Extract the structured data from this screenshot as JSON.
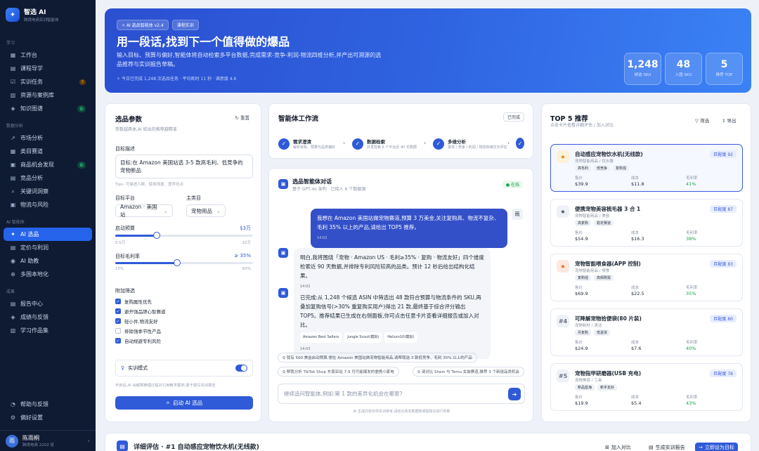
{
  "brand": {
    "name": "智选 AI",
    "subtitle": "跨境电商实训智能体"
  },
  "sidebar": {
    "sec_learn": "学习",
    "sec_data": "数据分析",
    "sec_ai": "AI 智能体",
    "sec_result": "成果",
    "learn": [
      {
        "label": "工作台",
        "icon": "▦"
      },
      {
        "label": "课程导学",
        "icon": "▤"
      },
      {
        "label": "实训任务",
        "icon": "☑",
        "badge": "3"
      },
      {
        "label": "资源与案例库",
        "icon": "▥"
      },
      {
        "label": "知识图谱",
        "icon": "◈",
        "badge": "新"
      }
    ],
    "data": [
      {
        "label": "市场分析",
        "icon": "↗"
      },
      {
        "label": "类目赛道",
        "icon": "▦"
      },
      {
        "label": "商品机会发现",
        "icon": "▣",
        "badge": "新"
      },
      {
        "label": "竞品分析",
        "icon": "▤"
      },
      {
        "label": "关键词洞察",
        "icon": "⌕"
      },
      {
        "label": "物流与风险",
        "icon": "▣"
      }
    ],
    "ai": [
      {
        "label": "AI 选品",
        "icon": "✦"
      },
      {
        "label": "定价与利润",
        "icon": "▤"
      },
      {
        "label": "AI 助教",
        "icon": "◉"
      },
      {
        "label": "多国本地化",
        "icon": "⊕"
      }
    ],
    "result": [
      {
        "label": "报告中心",
        "icon": "▤"
      },
      {
        "label": "成绩与反馈",
        "icon": "◈"
      },
      {
        "label": "学习作品集",
        "icon": "▥"
      }
    ],
    "bottom": [
      {
        "label": "帮助与反馈",
        "icon": "◔"
      },
      {
        "label": "偏好设置",
        "icon": "⚙"
      }
    ],
    "user": {
      "avatar": "雨",
      "name": "陈雨桐",
      "role": "跨境电商 2202 班"
    }
  },
  "hero": {
    "tag1": "AI 选品智能体 v2.4",
    "tag2": "课程实训",
    "title": "用一段话,找到下一个值得做的爆品",
    "desc": "输入目标、预算与偏好,智能体将自动检索多平台数据,完成需求-竞争-利润-物流四维分析,并产出可溯源的选品推荐与实训报告草稿。",
    "stat": "今日已完成 1,248 次选品任务 · 平均耗时 11 秒 · 满意度 4.6",
    "kpis": [
      {
        "value": "1,248",
        "label": "候选 SKU"
      },
      {
        "value": "48",
        "label": "入围 SKU"
      },
      {
        "value": "5",
        "label": "推荐 TOP"
      }
    ]
  },
  "params": {
    "title": "选品参数",
    "subtitle": "参数越具体,AI 给出的推荐越精准",
    "reset": "重置",
    "goal_label": "目标描述",
    "goal_value": "目标:在 Amazon 美国站选 3-5 款高毛利、低竞争的宠物新品",
    "tips": "Tips: 可描述人群、使用场景、差异化点",
    "platform_label": "目标平台",
    "platform_value": "Amazon · 美国站",
    "category_label": "主类目",
    "category_value": "宠物用品",
    "budget_label": "启动预算",
    "budget_value": "$3万",
    "budget_min": "0.5万",
    "budget_max": "10万",
    "budget_level": 0.3,
    "margin_label": "目标毛利率",
    "margin_value": "≥ 35%",
    "margin_min": "15%",
    "margin_max": "60%",
    "margin_level": 0.45,
    "filter_label": "附加筛选",
    "filters": [
      {
        "label": "复购属性优先",
        "checked": true
      },
      {
        "label": "避开强品牌心智赛道",
        "checked": true
      },
      {
        "label": "轻小件,物流友好",
        "checked": true
      },
      {
        "label": "排除强季节性产品",
        "checked": false
      },
      {
        "label": "自动规避专利风险",
        "checked": true
      }
    ],
    "mode_label": "实训模式",
    "mode_note": "开启后,AI 会解释推理过程并引用教学案例,便于撰写实训报告",
    "start": "启动 AI 选品"
  },
  "workflow": {
    "title": "智能体工作流",
    "status": "已完成",
    "steps": [
      {
        "title": "需求澄清",
        "sub": "解析目标、预算与品类偏好"
      },
      {
        "title": "数据检索",
        "sub": "并发检索 6 个平台近 90 天数据"
      },
      {
        "title": "多维分析",
        "sub": "需求 / 竞争 / 利润 / 物流四维交叉评估"
      }
    ]
  },
  "chat": {
    "title": "选品智能体对话",
    "subtitle": "基于 GPT-4o 架构 · 已接入 6 个数据源",
    "status": "在线",
    "user_avatar": "雨",
    "user_msg": "我想在 Amazon 美国站做宠物赛道,预算 3 万美金,关注复购高、物流不复杂、毛利 35% 以上的产品,请给出 TOP5 推荐。",
    "user_time": "14:02",
    "bot1": "明白,我将围绕「宠物 · Amazon US · 毛利≥35% · 复购 · 物流友好」四个维度检索近 90 天数据,并排除专利风险较高的品类。预计 12 秒后给出结构化结果。",
    "bot1_time": "14:02",
    "bot2": "已完成:从 1,248 个候选 ASIN 中筛选出 48 款符合预算与物流条件的 SKU,再叠加复购信号(>30% 重复购买用户)得出 21 款,最终基于综合评分输出 TOP5。推荐结果已生成在右侧面板,你可点击任意卡片查看详细报告或加入对比。",
    "refs": [
      "Amazon Best Sellers",
      "Jungle Scout(模拟)",
      "Helium10(模拟)"
    ],
    "bot2_time": "14:03",
    "chips": [
      "我有 500 美金启动预算,想在 Amazon 美国站做宠物智能用品,请帮我选 3 款低竞争、毛利 35% 以上的产品",
      "帮我分析 TikTok Shop 东南亚站 7-9 月可能爆发的便携小家电",
      "请对比 Shein 与 Temu 女装赛道,推荐 3 个新锐品类机会"
    ],
    "placeholder": "继续追问智能体,例如:第 1 款的差异化机会在哪里?",
    "disclaimer": "AI 生成内容仅供实训参考,请结合真实数据和课程知识进行判断"
  },
  "top5": {
    "title": "TOP 5 推荐",
    "subtitle": "点击卡片查看详细评估 / 加入对比",
    "filter": "筛选",
    "export": "导出",
    "col_price": "售价",
    "col_cost": "成本",
    "col_margin": "毛利率",
    "items": [
      {
        "rank": "★",
        "name": "自动感应宠物饮水机(无线款)",
        "cat": "宠物智能用品 / 饮水器",
        "tags": [
          "高毛利",
          "低竞争",
          "复购强"
        ],
        "match": "匹配度 92",
        "price": "$39.9",
        "cost": "$11.8",
        "margin": "41%"
      },
      {
        "rank": "★",
        "name": "便携宠物美容梳毛器 3 合 1",
        "cat": "宠物智能用品 / 美容",
        "tags": [
          "高复购",
          "稳定赛道"
        ],
        "match": "匹配度 87",
        "price": "$54.9",
        "cost": "$16.3",
        "margin": "38%"
      },
      {
        "rank": "★",
        "name": "宠物智能喂食器(APP 控制)",
        "cat": "宠物智能用品 / 喂食",
        "tags": [
          "复购强",
          "高频刚需"
        ],
        "match": "匹配度 83",
        "price": "$69.9",
        "cost": "$22.5",
        "margin": "35%"
      },
      {
        "rank": "#4",
        "name": "可降解宠物拾便袋(80 片装)",
        "cat": "宠物耗材 / 清洁",
        "tags": [
          "月复购",
          "低退货"
        ],
        "match": "匹配度 80",
        "price": "$24.9",
        "cost": "$7.6",
        "margin": "40%"
      },
      {
        "rank": "#5",
        "name": "宠物指甲研磨器(USB 充电)",
        "cat": "宠物美容 / 工具",
        "tags": [
          "新品蓝海",
          "新手友好"
        ],
        "match": "匹配度 78",
        "price": "$19.9",
        "cost": "$5.4",
        "margin": "43%"
      }
    ]
  },
  "bottom": {
    "title": "详细评估 · #1 自动感应宠物饮水机(无线款)",
    "compare": "加入对比",
    "report": "生成实训报告",
    "target": "立即设为目标"
  },
  "colors": {
    "accent": "#2f5ad8",
    "sidebar": "#0f1b33",
    "success": "#16a34a"
  }
}
